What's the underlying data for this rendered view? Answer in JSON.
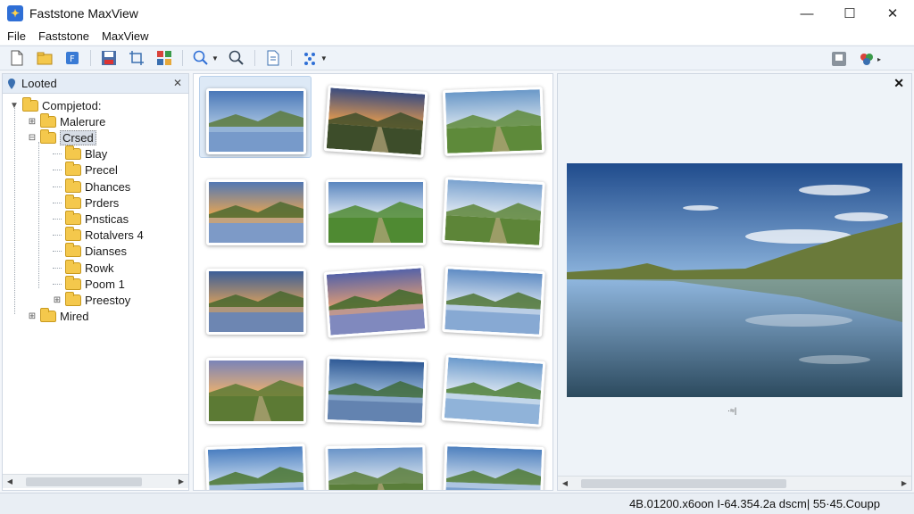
{
  "window": {
    "title": "Faststone MaxView"
  },
  "menu": {
    "items": [
      "File",
      "Faststone",
      "MaxView"
    ]
  },
  "toolbar": {
    "tools": [
      "new-file-icon",
      "open-folder-icon",
      "bookmark-icon",
      "save-icon",
      "crop-icon",
      "grid-icon",
      "zoom-in-icon",
      "search-icon",
      "page-icon",
      "effects-icon"
    ],
    "right_tools": [
      "print-icon",
      "color-wheel-icon"
    ]
  },
  "folder_panel": {
    "title": "Looted",
    "tree": [
      {
        "label": "Compjetod:",
        "level": 0,
        "expander": "▼"
      },
      {
        "label": "Malerure",
        "level": 1,
        "expander": "⊞"
      },
      {
        "label": "Crsed",
        "level": 1,
        "expander": "⊟",
        "selected": true
      },
      {
        "label": "Blay",
        "level": 2
      },
      {
        "label": "Precel",
        "level": 2
      },
      {
        "label": "Dhances",
        "level": 2
      },
      {
        "label": "Prders",
        "level": 2
      },
      {
        "label": "Pnsticas",
        "level": 2
      },
      {
        "label": "Rotalvers 4",
        "level": 2
      },
      {
        "label": "Dianses",
        "level": 2
      },
      {
        "label": "Rowk",
        "level": 2
      },
      {
        "label": "Poom 1",
        "level": 2
      },
      {
        "label": "Preestoy",
        "level": 2,
        "expander": "⊞"
      },
      {
        "label": "Mired",
        "level": 1,
        "expander": "⊞"
      }
    ]
  },
  "thumbnails": [
    {
      "sky": "#4a78b8",
      "horizon": "#a9c4e0",
      "ground": "#5c7a3c",
      "water": true,
      "selected": true
    },
    {
      "sky": "#3a4c80",
      "horizon": "#f0a04a",
      "ground": "#3d4d2a",
      "water": false
    },
    {
      "sky": "#6a98c8",
      "horizon": "#d8e4ee",
      "ground": "#5e8a3a",
      "water": false
    },
    {
      "sky": "#5278b4",
      "horizon": "#f1a84c",
      "ground": "#4c6a30",
      "water": true
    },
    {
      "sky": "#5a86bf",
      "horizon": "#e3ecf5",
      "ground": "#4f8a32",
      "water": false
    },
    {
      "sky": "#7aa2cf",
      "horizon": "#e6edf4",
      "ground": "#5d8538",
      "water": false
    },
    {
      "sky": "#3c5e98",
      "horizon": "#dda15a",
      "ground": "#46672e",
      "water": true
    },
    {
      "sky": "#5562a8",
      "horizon": "#e9a070",
      "ground": "#3f6a2c",
      "water": true
    },
    {
      "sky": "#5f8cc4",
      "horizon": "#dde7f1",
      "ground": "#4e7434",
      "water": true
    },
    {
      "sky": "#7b84b8",
      "horizon": "#f2b36a",
      "ground": "#5c7a34",
      "water": false
    },
    {
      "sky": "#2f5a96",
      "horizon": "#9fbddc",
      "ground": "#3e6a3a",
      "water": true
    },
    {
      "sky": "#6b9acc",
      "horizon": "#e4ecf4",
      "ground": "#4d7f36",
      "water": true
    },
    {
      "sky": "#4a7ec0",
      "horizon": "#c9dcef",
      "ground": "#4a7530",
      "water": true
    },
    {
      "sky": "#6a94c8",
      "horizon": "#dce6f0",
      "ground": "#5a7e3a",
      "water": false
    },
    {
      "sky": "#4e80be",
      "horizon": "#cfdeee",
      "ground": "#4f7a34",
      "water": true
    }
  ],
  "preview": {
    "sky_top": "#1f4b8c",
    "sky_bottom": "#8fb6de",
    "hill": "#6a7a3a",
    "water": "#2c4a5e",
    "caption": "·≈|"
  },
  "status": {
    "text": "4B.01200.x6oon I-64.354.2a dscm| 55·45.Coupp"
  }
}
